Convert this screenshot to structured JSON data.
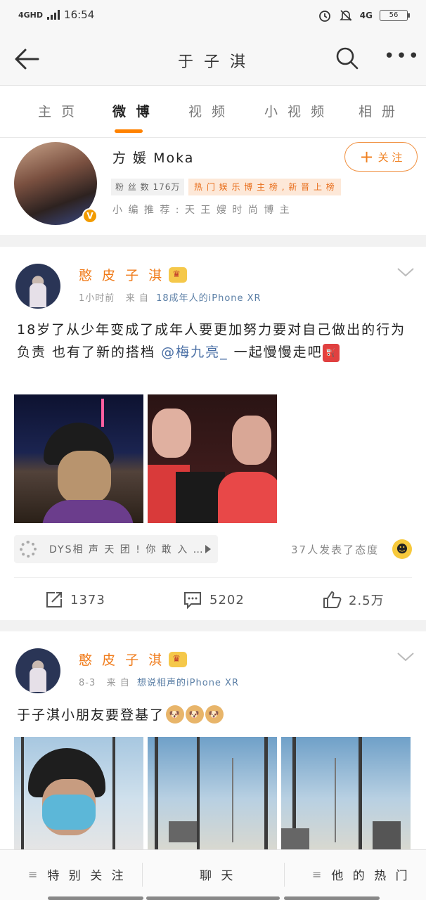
{
  "status_bar": {
    "network": "4GHD",
    "time": "16:54",
    "network_right": "4G",
    "battery": "56"
  },
  "nav": {
    "title": "于 子 淇"
  },
  "tabs": [
    "主 页",
    "微 博",
    "视 频",
    "小 视 频",
    "相 册"
  ],
  "active_tab": 1,
  "promo": {
    "name": "方 媛 Moka",
    "fans": "粉 丝 数 176万",
    "badge": "热 门 娱 乐 博 主 榜 , 新 晋 上 榜",
    "recommend": "小 编 推 荐 : 天 王 嫂 时 尚 博 主",
    "follow_label": "关 注",
    "verified_mark": "V"
  },
  "post1": {
    "author": "憨 皮 子 淇",
    "time": "1小时前",
    "from_label": "来 自",
    "source": "18成年人的iPhone XR",
    "text_before": "18岁了从少年变成了成年人要更加努力要对自己做出的行为负责 也有了新的搭档",
    "mention": "@梅九亮_",
    "text_after": "一起慢慢走吧",
    "quote": "DYS相 声 天 团 ! 你 敢 入 …",
    "attitude": "37人发表了态度",
    "repost_count": "1373",
    "comment_count": "5202",
    "like_count": "2.5万"
  },
  "post2": {
    "author": "憨 皮 子 淇",
    "time": "8-3",
    "from_label": "来 自",
    "source": "想说相声的iPhone XR",
    "text": "于子淇小朋友要登基了"
  },
  "bottom_bar": [
    "特 别 关 注",
    "聊 天",
    "他 的 热 门"
  ],
  "colors": {
    "accent": "#ff8200",
    "link": "#4a6fa5",
    "name": "#f07b1a"
  }
}
